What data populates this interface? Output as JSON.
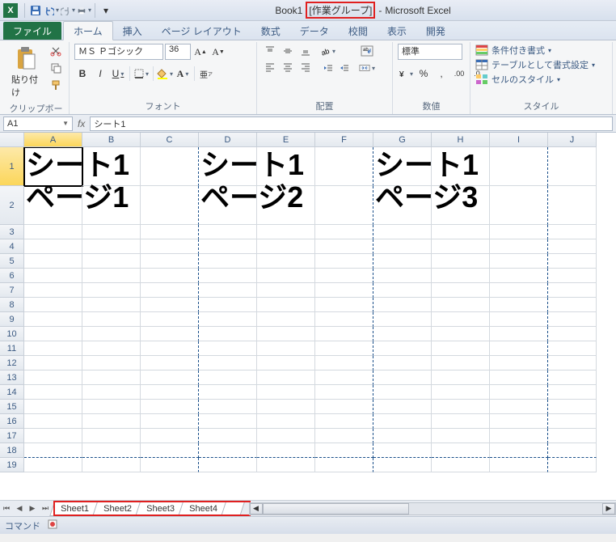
{
  "titlebar": {
    "book": "Book1",
    "workgroup": "[作業グループ]",
    "app": "Microsoft Excel",
    "dash": "-"
  },
  "tabs": {
    "file": "ファイル",
    "home": "ホーム",
    "insert": "挿入",
    "pagelayout": "ページ レイアウト",
    "formulas": "数式",
    "data": "データ",
    "review": "校閲",
    "view": "表示",
    "developer": "開発"
  },
  "ribbon": {
    "clipboard": {
      "paste": "貼り付け",
      "label": "クリップボード"
    },
    "font": {
      "name": "ＭＳ Ｐゴシック",
      "size": "36",
      "label": "フォント",
      "bold": "B",
      "italic": "I",
      "underline": "U"
    },
    "alignment": {
      "label": "配置"
    },
    "number": {
      "format": "標準",
      "label": "数値"
    },
    "styles": {
      "conditional": "条件付き書式",
      "table": "テーブルとして書式設定",
      "cell": "セルのスタイル",
      "label": "スタイル"
    }
  },
  "formula": {
    "namebox": "A1",
    "value": "シート1"
  },
  "columns": [
    "A",
    "B",
    "C",
    "D",
    "E",
    "F",
    "G",
    "H",
    "I",
    "J"
  ],
  "rows": [
    "1",
    "2",
    "3",
    "4",
    "5",
    "6",
    "7",
    "8",
    "9",
    "10",
    "11",
    "12",
    "13",
    "14",
    "15",
    "16",
    "17",
    "18",
    "19"
  ],
  "cells": {
    "block1": {
      "line1": "シート1",
      "line2": "ページ1"
    },
    "block2": {
      "line1": "シート1",
      "line2": "ページ2"
    },
    "block3": {
      "line1": "シート1",
      "line2": "ページ3"
    }
  },
  "sheets": [
    "Sheet1",
    "Sheet2",
    "Sheet3",
    "Sheet4"
  ],
  "status": {
    "mode": "コマンド"
  }
}
